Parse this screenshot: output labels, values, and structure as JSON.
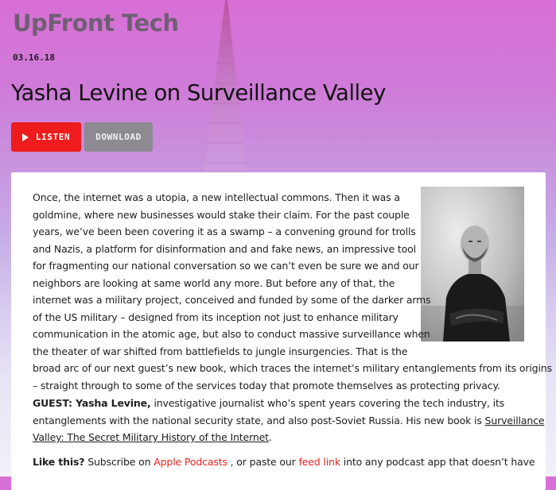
{
  "header": {
    "show_title": "UpFront Tech",
    "date": "03.16.18",
    "episode_title": "Yasha Levine on Surveillance Valley"
  },
  "buttons": {
    "listen_label": "LISTEN",
    "download_label": "DOWNLOAD"
  },
  "colors": {
    "accent": "#ee1c1c",
    "download_bg": "#8d8a91",
    "link": "#e8231f"
  },
  "description_lines": [
    "Once, the internet was a utopia, a new intellectual commons. Then it was a",
    "goldmine, where new businesses would stake their claim. For the past couple",
    "years, we’ve been been covering it as a swamp – a convening ground for trolls",
    "and Nazis, a platform for disinformation and and fake news, an impressive tool",
    "for fragmenting our national conversation so we can’t even be sure we and our",
    "neighbors are looking at same world any more. But before any of that, the",
    "internet was a military project, conceived and funded by some of the darker arms",
    "of the US military – designed from its inception not just to enhance military",
    "communication in the atomic age, but also to conduct massive surveillance when",
    "the theater of war shifted from battlefields to jungle insurgencies. That is the",
    "broad arc of our next guest’s new book, which traces the internet’s military entanglements from its origins",
    "–  straight through to some of the services today that promote themselves as protecting privacy."
  ],
  "guest": {
    "label": "GUEST: Yasha Levine,",
    "line1_rest": " investigative journalist who’s spent years covering the tech industry, its",
    "line2_start": "entanglements with the national security state, and also post-Soviet Russia. His new book is ",
    "book_part1": "Surveillance",
    "book_part2": "Valley: The Secret Military History of the Internet",
    "line3_end": "."
  },
  "promo": {
    "label": "Like this?",
    "text1": " Subscribe on ",
    "apple_link": "Apple Podcasts",
    "text2": " , or paste our ",
    "feed_link": "feed link",
    "text3": " into any podcast app that doesn’t have"
  },
  "icons": {
    "listen": "play-icon"
  }
}
